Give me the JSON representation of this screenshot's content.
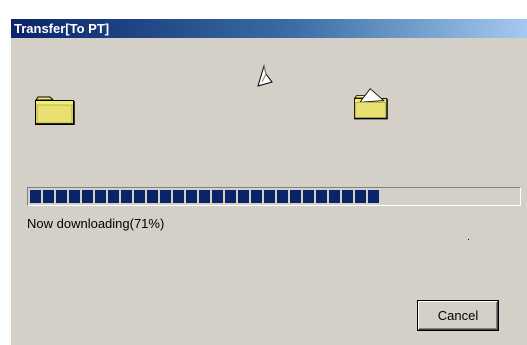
{
  "window": {
    "title": "Transfer[To PT]"
  },
  "icons": {
    "source": "folder-icon",
    "destination": "open-folder-icon",
    "transfer": "paper-sheet-icon"
  },
  "progress": {
    "percent": 71,
    "status_text": "Now downloading(71%)"
  },
  "buttons": {
    "cancel_label": "Cancel"
  },
  "colors": {
    "titlebar": "#0a246a",
    "progress_block": "#0a246a",
    "dialog_bg": "#d4d0c8",
    "folder": "#f0ec74"
  }
}
